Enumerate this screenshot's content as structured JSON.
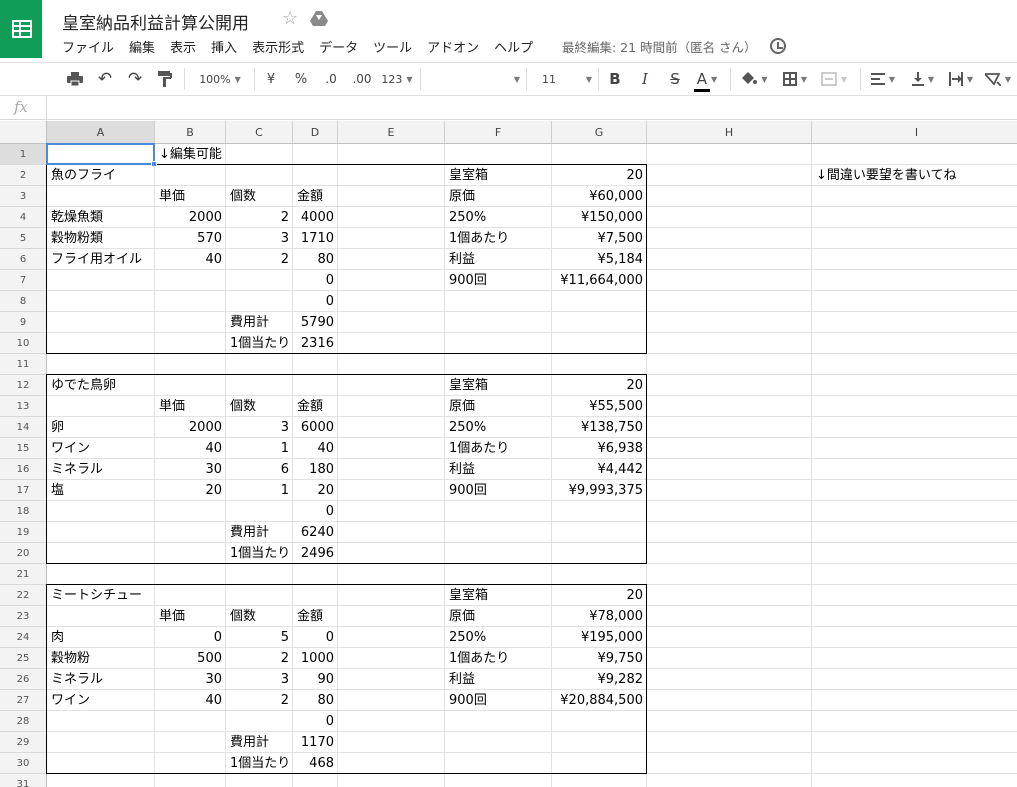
{
  "app": {
    "title": "皇室納品利益計算公開用",
    "menus": [
      "ファイル",
      "編集",
      "表示",
      "挿入",
      "表示形式",
      "データ",
      "ツール",
      "アドオン",
      "ヘルプ"
    ],
    "last_edit": "最終編集: 21 時間前（匿名 さん）",
    "accent_color": "#0f9d58"
  },
  "toolbar": {
    "zoom": "100%",
    "currency": "¥",
    "percent": "%",
    "decimal_decrease": ".0",
    "decimal_increase": ".00",
    "format_more": "123",
    "font_size": "11",
    "bold": "B",
    "italic": "I",
    "strike": "S",
    "text_color": "A"
  },
  "formula_bar": {
    "fx": "fx",
    "value": ""
  },
  "columns": [
    "A",
    "B",
    "C",
    "D",
    "E",
    "F",
    "G",
    "H",
    "I"
  ],
  "rows": [
    "1",
    "2",
    "3",
    "4",
    "5",
    "6",
    "7",
    "8",
    "9",
    "10",
    "11",
    "12",
    "13",
    "14",
    "15",
    "16",
    "17",
    "18",
    "19",
    "20",
    "21",
    "22",
    "23",
    "24",
    "25",
    "26",
    "27",
    "28",
    "29",
    "30",
    "31"
  ],
  "selected_cell": "A1",
  "cells": [
    {
      "r": 1,
      "c": "B",
      "v": "↓編集可能"
    },
    {
      "r": 2,
      "c": "A",
      "v": "魚のフライ"
    },
    {
      "r": 2,
      "c": "F",
      "v": "皇室箱"
    },
    {
      "r": 2,
      "c": "G",
      "v": "20",
      "align": "r"
    },
    {
      "r": 2,
      "c": "I",
      "v": "↓間違い要望を書いてね"
    },
    {
      "r": 3,
      "c": "B",
      "v": "単価"
    },
    {
      "r": 3,
      "c": "C",
      "v": "個数"
    },
    {
      "r": 3,
      "c": "D",
      "v": "金額"
    },
    {
      "r": 3,
      "c": "F",
      "v": "原価"
    },
    {
      "r": 3,
      "c": "G",
      "v": "¥60,000",
      "align": "r"
    },
    {
      "r": 4,
      "c": "A",
      "v": "乾燥魚類"
    },
    {
      "r": 4,
      "c": "B",
      "v": "2000",
      "align": "r"
    },
    {
      "r": 4,
      "c": "C",
      "v": "2",
      "align": "r"
    },
    {
      "r": 4,
      "c": "D",
      "v": "4000",
      "align": "r"
    },
    {
      "r": 4,
      "c": "F",
      "v": "250%"
    },
    {
      "r": 4,
      "c": "G",
      "v": "¥150,000",
      "align": "r"
    },
    {
      "r": 5,
      "c": "A",
      "v": "穀物粉類"
    },
    {
      "r": 5,
      "c": "B",
      "v": "570",
      "align": "r"
    },
    {
      "r": 5,
      "c": "C",
      "v": "3",
      "align": "r"
    },
    {
      "r": 5,
      "c": "D",
      "v": "1710",
      "align": "r"
    },
    {
      "r": 5,
      "c": "F",
      "v": "1個あたり"
    },
    {
      "r": 5,
      "c": "G",
      "v": "¥7,500",
      "align": "r"
    },
    {
      "r": 6,
      "c": "A",
      "v": "フライ用オイル"
    },
    {
      "r": 6,
      "c": "B",
      "v": "40",
      "align": "r"
    },
    {
      "r": 6,
      "c": "C",
      "v": "2",
      "align": "r"
    },
    {
      "r": 6,
      "c": "D",
      "v": "80",
      "align": "r"
    },
    {
      "r": 6,
      "c": "F",
      "v": "利益"
    },
    {
      "r": 6,
      "c": "G",
      "v": "¥5,184",
      "align": "r"
    },
    {
      "r": 7,
      "c": "D",
      "v": "0",
      "align": "r"
    },
    {
      "r": 7,
      "c": "F",
      "v": "900回"
    },
    {
      "r": 7,
      "c": "G",
      "v": "¥11,664,000",
      "align": "r"
    },
    {
      "r": 8,
      "c": "D",
      "v": "0",
      "align": "r"
    },
    {
      "r": 9,
      "c": "C",
      "v": "費用計"
    },
    {
      "r": 9,
      "c": "D",
      "v": "5790",
      "align": "r"
    },
    {
      "r": 10,
      "c": "C",
      "v": "1個当たり"
    },
    {
      "r": 10,
      "c": "D",
      "v": "2316",
      "align": "r"
    },
    {
      "r": 12,
      "c": "A",
      "v": "ゆでた鳥卵"
    },
    {
      "r": 12,
      "c": "F",
      "v": "皇室箱"
    },
    {
      "r": 12,
      "c": "G",
      "v": "20",
      "align": "r"
    },
    {
      "r": 13,
      "c": "B",
      "v": "単価"
    },
    {
      "r": 13,
      "c": "C",
      "v": "個数"
    },
    {
      "r": 13,
      "c": "D",
      "v": "金額"
    },
    {
      "r": 13,
      "c": "F",
      "v": "原価"
    },
    {
      "r": 13,
      "c": "G",
      "v": "¥55,500",
      "align": "r"
    },
    {
      "r": 14,
      "c": "A",
      "v": "卵"
    },
    {
      "r": 14,
      "c": "B",
      "v": "2000",
      "align": "r"
    },
    {
      "r": 14,
      "c": "C",
      "v": "3",
      "align": "r"
    },
    {
      "r": 14,
      "c": "D",
      "v": "6000",
      "align": "r"
    },
    {
      "r": 14,
      "c": "F",
      "v": "250%"
    },
    {
      "r": 14,
      "c": "G",
      "v": "¥138,750",
      "align": "r"
    },
    {
      "r": 15,
      "c": "A",
      "v": "ワイン"
    },
    {
      "r": 15,
      "c": "B",
      "v": "40",
      "align": "r"
    },
    {
      "r": 15,
      "c": "C",
      "v": "1",
      "align": "r"
    },
    {
      "r": 15,
      "c": "D",
      "v": "40",
      "align": "r"
    },
    {
      "r": 15,
      "c": "F",
      "v": "1個あたり"
    },
    {
      "r": 15,
      "c": "G",
      "v": "¥6,938",
      "align": "r"
    },
    {
      "r": 16,
      "c": "A",
      "v": "ミネラル"
    },
    {
      "r": 16,
      "c": "B",
      "v": "30",
      "align": "r"
    },
    {
      "r": 16,
      "c": "C",
      "v": "6",
      "align": "r"
    },
    {
      "r": 16,
      "c": "D",
      "v": "180",
      "align": "r"
    },
    {
      "r": 16,
      "c": "F",
      "v": "利益"
    },
    {
      "r": 16,
      "c": "G",
      "v": "¥4,442",
      "align": "r"
    },
    {
      "r": 17,
      "c": "A",
      "v": "塩"
    },
    {
      "r": 17,
      "c": "B",
      "v": "20",
      "align": "r"
    },
    {
      "r": 17,
      "c": "C",
      "v": "1",
      "align": "r"
    },
    {
      "r": 17,
      "c": "D",
      "v": "20",
      "align": "r"
    },
    {
      "r": 17,
      "c": "F",
      "v": "900回"
    },
    {
      "r": 17,
      "c": "G",
      "v": "¥9,993,375",
      "align": "r"
    },
    {
      "r": 18,
      "c": "D",
      "v": "0",
      "align": "r"
    },
    {
      "r": 19,
      "c": "C",
      "v": "費用計"
    },
    {
      "r": 19,
      "c": "D",
      "v": "6240",
      "align": "r"
    },
    {
      "r": 20,
      "c": "C",
      "v": "1個当たり"
    },
    {
      "r": 20,
      "c": "D",
      "v": "2496",
      "align": "r"
    },
    {
      "r": 22,
      "c": "A",
      "v": "ミートシチュー"
    },
    {
      "r": 22,
      "c": "F",
      "v": "皇室箱"
    },
    {
      "r": 22,
      "c": "G",
      "v": "20",
      "align": "r"
    },
    {
      "r": 23,
      "c": "B",
      "v": "単価"
    },
    {
      "r": 23,
      "c": "C",
      "v": "個数"
    },
    {
      "r": 23,
      "c": "D",
      "v": "金額"
    },
    {
      "r": 23,
      "c": "F",
      "v": "原価"
    },
    {
      "r": 23,
      "c": "G",
      "v": "¥78,000",
      "align": "r"
    },
    {
      "r": 24,
      "c": "A",
      "v": "肉"
    },
    {
      "r": 24,
      "c": "B",
      "v": "0",
      "align": "r"
    },
    {
      "r": 24,
      "c": "C",
      "v": "5",
      "align": "r"
    },
    {
      "r": 24,
      "c": "D",
      "v": "0",
      "align": "r"
    },
    {
      "r": 24,
      "c": "F",
      "v": "250%"
    },
    {
      "r": 24,
      "c": "G",
      "v": "¥195,000",
      "align": "r"
    },
    {
      "r": 25,
      "c": "A",
      "v": "穀物粉"
    },
    {
      "r": 25,
      "c": "B",
      "v": "500",
      "align": "r"
    },
    {
      "r": 25,
      "c": "C",
      "v": "2",
      "align": "r"
    },
    {
      "r": 25,
      "c": "D",
      "v": "1000",
      "align": "r"
    },
    {
      "r": 25,
      "c": "F",
      "v": "1個あたり"
    },
    {
      "r": 25,
      "c": "G",
      "v": "¥9,750",
      "align": "r"
    },
    {
      "r": 26,
      "c": "A",
      "v": "ミネラル"
    },
    {
      "r": 26,
      "c": "B",
      "v": "30",
      "align": "r"
    },
    {
      "r": 26,
      "c": "C",
      "v": "3",
      "align": "r"
    },
    {
      "r": 26,
      "c": "D",
      "v": "90",
      "align": "r"
    },
    {
      "r": 26,
      "c": "F",
      "v": "利益"
    },
    {
      "r": 26,
      "c": "G",
      "v": "¥9,282",
      "align": "r"
    },
    {
      "r": 27,
      "c": "A",
      "v": "ワイン"
    },
    {
      "r": 27,
      "c": "B",
      "v": "40",
      "align": "r"
    },
    {
      "r": 27,
      "c": "C",
      "v": "2",
      "align": "r"
    },
    {
      "r": 27,
      "c": "D",
      "v": "80",
      "align": "r"
    },
    {
      "r": 27,
      "c": "F",
      "v": "900回"
    },
    {
      "r": 27,
      "c": "G",
      "v": "¥20,884,500",
      "align": "r"
    },
    {
      "r": 28,
      "c": "D",
      "v": "0",
      "align": "r"
    },
    {
      "r": 29,
      "c": "C",
      "v": "費用計"
    },
    {
      "r": 29,
      "c": "D",
      "v": "1170",
      "align": "r"
    },
    {
      "r": 30,
      "c": "C",
      "v": "1個当たり"
    },
    {
      "r": 30,
      "c": "D",
      "v": "468",
      "align": "r"
    }
  ]
}
